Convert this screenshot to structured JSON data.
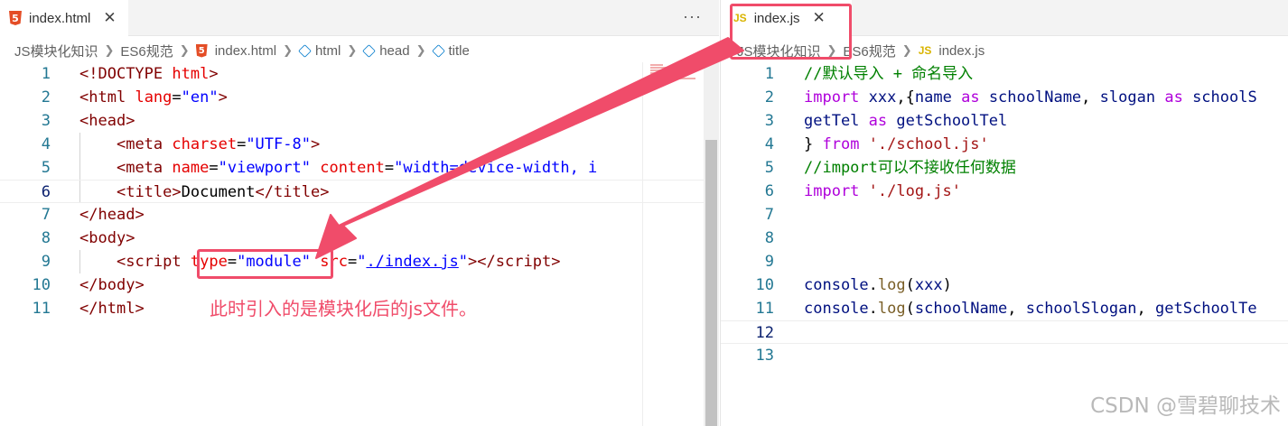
{
  "left_editor": {
    "tab_label": "index.html",
    "close_glyph": "✕",
    "more_glyph": "···",
    "breadcrumbs": [
      "JS模块化知识",
      "ES6规范",
      "index.html",
      "html",
      "head",
      "title"
    ],
    "line_numbers": [
      "1",
      "2",
      "3",
      "4",
      "5",
      "6",
      "7",
      "8",
      "9",
      "10",
      "11"
    ],
    "active_line": "6",
    "lines": [
      [
        [
          "t-punc",
          "<!"
        ],
        [
          "t-tag",
          "DOCTYPE"
        ],
        [
          "t-text",
          " "
        ],
        [
          "t-attr",
          "html"
        ],
        [
          "t-punc",
          ">"
        ]
      ],
      [
        [
          "t-punc",
          "<"
        ],
        [
          "t-tag",
          "html"
        ],
        [
          "t-text",
          " "
        ],
        [
          "t-attr",
          "lang"
        ],
        [
          "t-text",
          "="
        ],
        [
          "t-str",
          "\"en\""
        ],
        [
          "t-punc",
          ">"
        ]
      ],
      [
        [
          "t-punc",
          "<"
        ],
        [
          "t-tag",
          "head"
        ],
        [
          "t-punc",
          ">"
        ]
      ],
      [
        [
          "t-text",
          "    "
        ],
        [
          "t-punc",
          "<"
        ],
        [
          "t-tag",
          "meta"
        ],
        [
          "t-text",
          " "
        ],
        [
          "t-attr",
          "charset"
        ],
        [
          "t-text",
          "="
        ],
        [
          "t-str",
          "\"UTF-8\""
        ],
        [
          "t-punc",
          ">"
        ]
      ],
      [
        [
          "t-text",
          "    "
        ],
        [
          "t-punc",
          "<"
        ],
        [
          "t-tag",
          "meta"
        ],
        [
          "t-text",
          " "
        ],
        [
          "t-attr",
          "name"
        ],
        [
          "t-text",
          "="
        ],
        [
          "t-str",
          "\"viewport\""
        ],
        [
          "t-text",
          " "
        ],
        [
          "t-attr",
          "content"
        ],
        [
          "t-text",
          "="
        ],
        [
          "t-str",
          "\"width=device-width, i"
        ]
      ],
      [
        [
          "t-text",
          "    "
        ],
        [
          "t-punc",
          "<"
        ],
        [
          "t-tag",
          "title"
        ],
        [
          "t-punc",
          ">"
        ],
        [
          "t-text",
          "Document"
        ],
        [
          "t-punc",
          "</"
        ],
        [
          "t-tag",
          "title"
        ],
        [
          "t-punc",
          ">"
        ]
      ],
      [
        [
          "t-punc",
          "</"
        ],
        [
          "t-tag",
          "head"
        ],
        [
          "t-punc",
          ">"
        ]
      ],
      [
        [
          "t-punc",
          "<"
        ],
        [
          "t-tag",
          "body"
        ],
        [
          "t-punc",
          ">"
        ]
      ],
      [
        [
          "t-text",
          "    "
        ],
        [
          "t-punc",
          "<"
        ],
        [
          "t-tag",
          "script"
        ],
        [
          "t-text",
          " "
        ],
        [
          "t-attr",
          "type"
        ],
        [
          "t-text",
          "="
        ],
        [
          "t-str",
          "\"module\""
        ],
        [
          "t-text",
          " "
        ],
        [
          "t-attr",
          "src"
        ],
        [
          "t-text",
          "="
        ],
        [
          "t-str",
          "\""
        ],
        [
          "t-link",
          "./index.js"
        ],
        [
          "t-str",
          "\""
        ],
        [
          "t-punc",
          "></"
        ],
        [
          "t-tag",
          "script"
        ],
        [
          "t-punc",
          ">"
        ]
      ],
      [
        [
          "t-punc",
          "</"
        ],
        [
          "t-tag",
          "body"
        ],
        [
          "t-punc",
          ">"
        ]
      ],
      [
        [
          "t-punc",
          "</"
        ],
        [
          "t-tag",
          "html"
        ],
        [
          "t-punc",
          ">"
        ]
      ]
    ]
  },
  "right_editor": {
    "tab_label": "index.js",
    "close_glyph": "✕",
    "breadcrumbs": [
      "JS模块化知识",
      "ES6规范",
      "index.js"
    ],
    "line_numbers": [
      "1",
      "2",
      "3",
      "4",
      "5",
      "6",
      "7",
      "8",
      "9",
      "10",
      "11",
      "12",
      "13"
    ],
    "active_line": "12",
    "lines": [
      [
        [
          "t-comment",
          "//默认导入 + 命名导入"
        ]
      ],
      [
        [
          "t-kw",
          "import"
        ],
        [
          "t-plain",
          " "
        ],
        [
          "t-id",
          "xxx"
        ],
        [
          "t-plain",
          ",{"
        ],
        [
          "t-id",
          "name"
        ],
        [
          "t-plain",
          " "
        ],
        [
          "t-kw",
          "as"
        ],
        [
          "t-plain",
          " "
        ],
        [
          "t-id",
          "schoolName"
        ],
        [
          "t-plain",
          ", "
        ],
        [
          "t-id",
          "slogan"
        ],
        [
          "t-plain",
          " "
        ],
        [
          "t-kw",
          "as"
        ],
        [
          "t-plain",
          " "
        ],
        [
          "t-id",
          "schoolS"
        ]
      ],
      [
        [
          "t-id",
          "getTel"
        ],
        [
          "t-plain",
          " "
        ],
        [
          "t-kw",
          "as"
        ],
        [
          "t-plain",
          " "
        ],
        [
          "t-id",
          "getSchoolTel"
        ]
      ],
      [
        [
          "t-plain",
          "} "
        ],
        [
          "t-kw",
          "from"
        ],
        [
          "t-plain",
          " "
        ],
        [
          "t-jsstr",
          "'./school.js'"
        ]
      ],
      [
        [
          "t-comment",
          "//import可以不接收任何数据"
        ]
      ],
      [
        [
          "t-kw",
          "import"
        ],
        [
          "t-plain",
          " "
        ],
        [
          "t-jsstr",
          "'./log.js'"
        ]
      ],
      [],
      [],
      [],
      [
        [
          "t-id",
          "console"
        ],
        [
          "t-plain",
          "."
        ],
        [
          "t-fn",
          "log"
        ],
        [
          "t-plain",
          "("
        ],
        [
          "t-id",
          "xxx"
        ],
        [
          "t-plain",
          ")"
        ]
      ],
      [
        [
          "t-id",
          "console"
        ],
        [
          "t-plain",
          "."
        ],
        [
          "t-fn",
          "log"
        ],
        [
          "t-plain",
          "("
        ],
        [
          "t-id",
          "schoolName"
        ],
        [
          "t-plain",
          ", "
        ],
        [
          "t-id",
          "schoolSlogan"
        ],
        [
          "t-plain",
          ", "
        ],
        [
          "t-id",
          "getSchoolTe"
        ]
      ],
      [],
      []
    ]
  },
  "annotation": {
    "text": "此时引入的是模块化后的js文件。",
    "color": "#f04c6a"
  },
  "watermark": "CSDN @雪碧聊技术"
}
